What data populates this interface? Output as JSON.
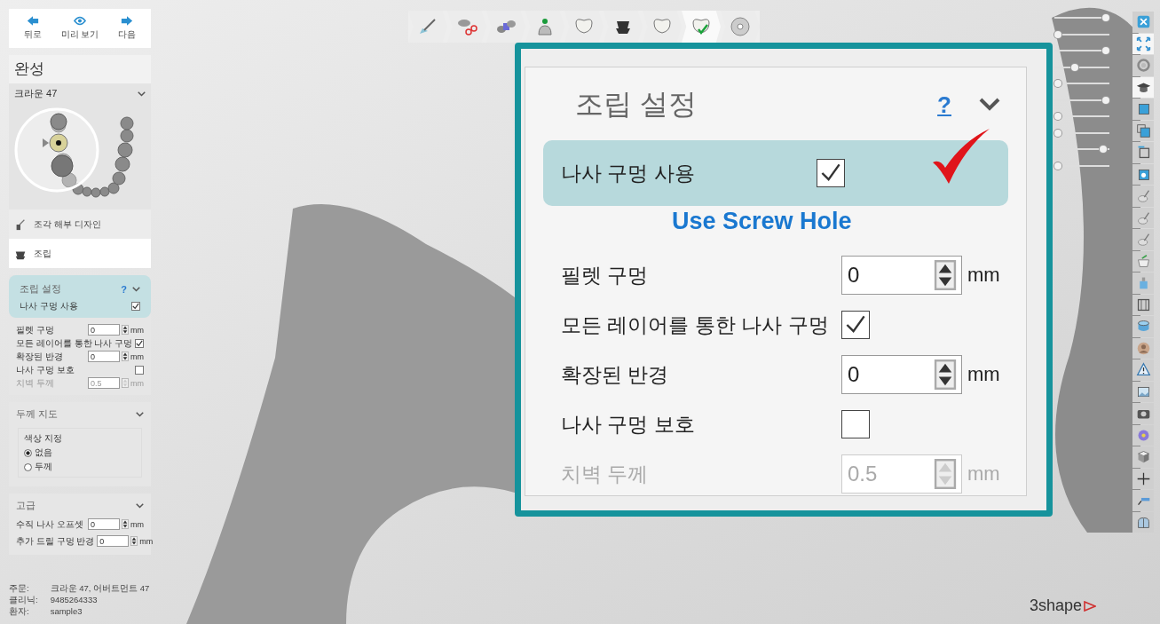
{
  "nav_buttons": [
    {
      "kind": "back",
      "label": "뒤로"
    },
    {
      "kind": "preview",
      "label": "미리 보기"
    },
    {
      "kind": "next",
      "label": "다음"
    }
  ],
  "step_title": "완성",
  "tooth_selector": {
    "label": "크라운 47"
  },
  "workflow_items": [
    {
      "kind": "anatomy",
      "label": "조각 해부 디자인",
      "selected": false
    },
    {
      "kind": "assembly",
      "label": "조립",
      "selected": true
    }
  ],
  "assembly_settings": {
    "title": "조립 설정",
    "help": "?",
    "rows": [
      {
        "kind": "check",
        "label": "나사 구멍 사용",
        "checked": true,
        "highlighted": true
      },
      {
        "kind": "number",
        "label": "필렛 구멍",
        "value": "0",
        "unit": "mm",
        "disabled": false
      },
      {
        "kind": "check",
        "label": "모든 레이어를 통한 나사 구멍",
        "checked": true,
        "highlighted": false
      },
      {
        "kind": "number",
        "label": "확장된 반경",
        "value": "0",
        "unit": "mm",
        "disabled": false
      },
      {
        "kind": "check",
        "label": "나사 구멍 보호",
        "checked": false,
        "highlighted": false
      },
      {
        "kind": "number",
        "label": "치벽 두께",
        "value": "0.5",
        "unit": "mm",
        "disabled": true
      }
    ]
  },
  "thickness_map": {
    "title": "두께 지도",
    "group_label": "색상 지정",
    "options": [
      {
        "label": "없음",
        "selected": true
      },
      {
        "label": "두께",
        "selected": false
      }
    ]
  },
  "advanced": {
    "title": "고급",
    "rows": [
      {
        "label": "수직 나사 오프셋",
        "value": "0",
        "unit": "mm"
      },
      {
        "label": "추가 드릴 구멍 반경",
        "value": "0",
        "unit": "mm"
      }
    ]
  },
  "order_info": [
    {
      "label": "주문:",
      "value": "크라운 47, 어버트먼트 47"
    },
    {
      "label": "클리닉:",
      "value": "9485264333"
    },
    {
      "label": "환자:",
      "value": "sample3"
    }
  ],
  "workflow_steps": [
    {
      "kind": "pen",
      "selected": false
    },
    {
      "kind": "scissors",
      "selected": false
    },
    {
      "kind": "models",
      "selected": false
    },
    {
      "kind": "implant",
      "selected": false
    },
    {
      "kind": "tooth",
      "selected": false
    },
    {
      "kind": "abutment",
      "selected": false
    },
    {
      "kind": "tooth",
      "selected": false
    },
    {
      "kind": "tooth-check",
      "selected": true
    },
    {
      "kind": "disc",
      "selected": false
    }
  ],
  "visibility_sliders": [
    {
      "level": 1
    },
    {
      "level": 0
    },
    {
      "level": 1
    },
    {
      "level": 0.35
    },
    {
      "level": 0
    },
    {
      "level": 1
    },
    {
      "level": 0
    },
    {
      "level": 0
    },
    {
      "level": 0.95
    },
    {
      "level": 0
    }
  ],
  "side_tools": [
    {
      "kind": "close",
      "selected": false
    },
    {
      "kind": "expand",
      "selected": true
    },
    {
      "kind": "rotate",
      "selected": false
    },
    {
      "kind": "cap",
      "selected": true
    },
    {
      "kind": "square",
      "selected": false
    },
    {
      "kind": "square-stack",
      "selected": false
    },
    {
      "kind": "square-outline",
      "selected": false
    },
    {
      "kind": "square-tooth",
      "selected": false
    },
    {
      "kind": "tooth-pen",
      "selected": false
    },
    {
      "kind": "tooth-pen",
      "selected": false
    },
    {
      "kind": "tooth-pen",
      "selected": false
    },
    {
      "kind": "bowl",
      "selected": false
    },
    {
      "kind": "bottle",
      "selected": false
    },
    {
      "kind": "frame",
      "selected": false
    },
    {
      "kind": "cylinder",
      "selected": false
    },
    {
      "kind": "person",
      "selected": false
    },
    {
      "kind": "warning",
      "selected": false
    },
    {
      "kind": "picture",
      "selected": false
    },
    {
      "kind": "camera",
      "selected": false
    },
    {
      "kind": "flower",
      "selected": false
    },
    {
      "kind": "cube",
      "selected": false
    },
    {
      "kind": "axes",
      "selected": false
    },
    {
      "kind": "ruler",
      "selected": false
    },
    {
      "kind": "teeth",
      "selected": false
    }
  ],
  "callout": {
    "title": "조립 설정",
    "help": "?",
    "rows": [
      {
        "kind": "check",
        "label": "나사 구멍 사용",
        "checked": true,
        "highlighted": true
      },
      {
        "kind": "number",
        "label": "필렛 구멍",
        "value": "0",
        "unit": "mm",
        "disabled": false
      },
      {
        "kind": "check",
        "label": "모든 레이어를 통한 나사 구멍",
        "checked": true,
        "highlighted": false
      },
      {
        "kind": "number",
        "label": "확장된 반경",
        "value": "0",
        "unit": "mm",
        "disabled": false
      },
      {
        "kind": "check",
        "label": "나사 구멍 보호",
        "checked": false,
        "highlighted": false
      },
      {
        "kind": "number",
        "label": "치벽 두께",
        "value": "0.5",
        "unit": "mm",
        "disabled": true
      }
    ],
    "annotation": "Use Screw Hole"
  },
  "brand": "3shape"
}
